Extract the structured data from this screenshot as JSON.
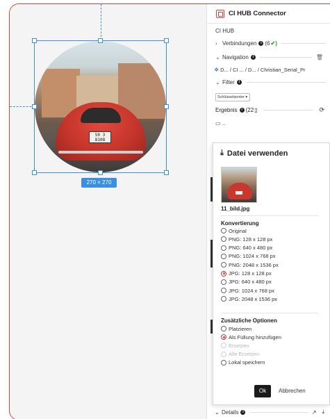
{
  "canvas": {
    "dimension_label": "270 × 270",
    "plate_text": "50 3\n8108"
  },
  "panel": {
    "title": "CI HUB Connector",
    "section_label": "CI HUB",
    "connections_label": "Verbindungen",
    "connections_count": "(6",
    "connections_check": "✔)",
    "navigation_label": "Navigation",
    "breadcrumb": [
      "D...",
      "/ CI ...",
      "/ D...",
      "/ Christian_Serial_Pr"
    ],
    "filter_label": "Filter",
    "keyword_select": "Schlüsselworter",
    "result_label": "Ergebnis",
    "result_count": "(22",
    "folder_label": "..",
    "details_label": "Details"
  },
  "dialog": {
    "title": "Datei verwenden",
    "file_name": "11_bild.jpg",
    "conversion_heading": "Konvertierung",
    "conversion_options": [
      {
        "label": "Original",
        "selected": false
      },
      {
        "label": "PNG: 128 x 128 px",
        "selected": false
      },
      {
        "label": "PNG: 640 x 480 px",
        "selected": false
      },
      {
        "label": "PNG: 1024 x 768 px",
        "selected": false
      },
      {
        "label": "PNG: 2048 x 1536 px",
        "selected": false
      },
      {
        "label": "JPG: 128 x 128 px",
        "selected": true
      },
      {
        "label": "JPG: 640 x 480 px",
        "selected": false
      },
      {
        "label": "JPG: 1024 x 768 px",
        "selected": false
      },
      {
        "label": "JPG: 2048 x 1536 px",
        "selected": false
      }
    ],
    "extra_heading": "Zusätzliche Optionen",
    "extra_options": [
      {
        "label": "Platzieren",
        "selected": false,
        "disabled": false
      },
      {
        "label": "Als Füllung hinzufügen",
        "selected": true,
        "disabled": false
      },
      {
        "label": "Ersetzen",
        "selected": false,
        "disabled": true
      },
      {
        "label": "Alle Ersetzen",
        "selected": false,
        "disabled": true
      },
      {
        "label": "Lokal speichern",
        "selected": false,
        "disabled": false
      }
    ],
    "ok_label": "Ok",
    "cancel_label": "Abbrechen"
  },
  "colors": {
    "frame": "#d9403a",
    "selection": "#3b8fe0",
    "radio_selected": "#d9403a"
  },
  "icons": [
    "logo-icon",
    "info-icon",
    "chevron-right-icon",
    "chevron-down-icon",
    "trash-icon",
    "folder-icon",
    "file-icon",
    "sync-icon",
    "download-icon",
    "external-link-icon"
  ]
}
